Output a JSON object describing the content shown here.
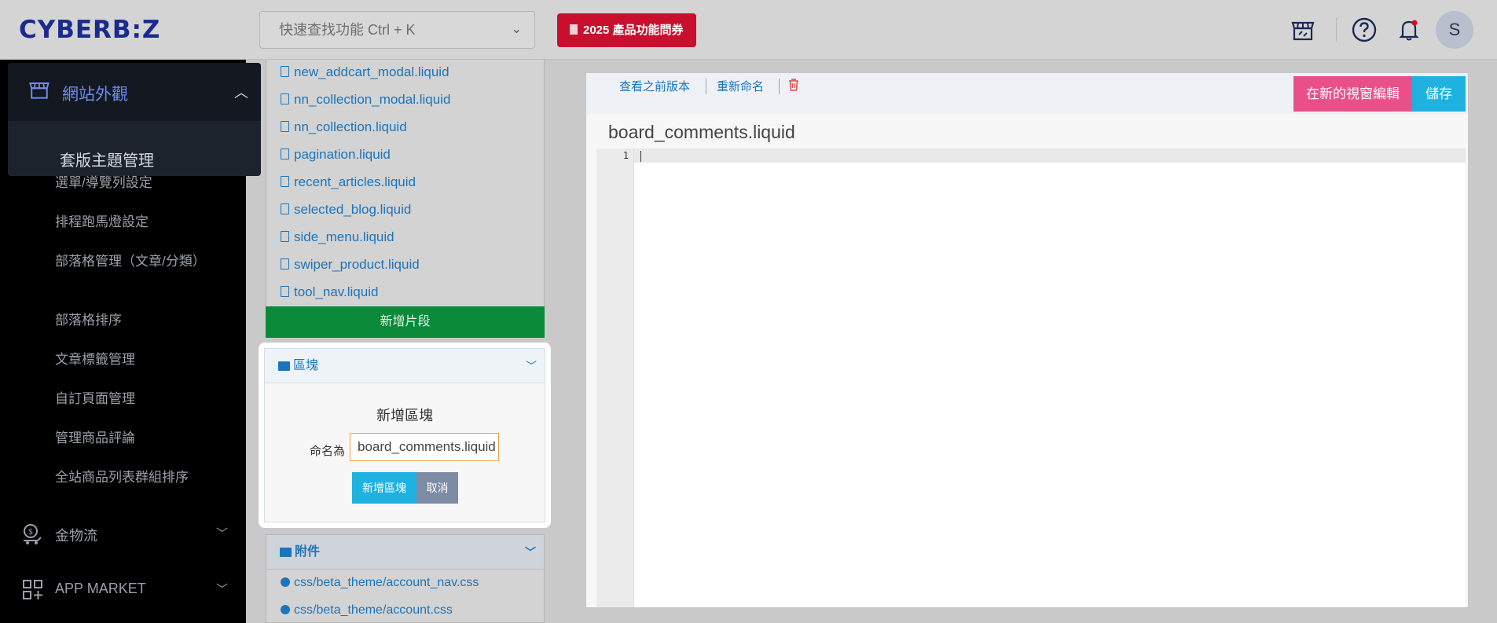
{
  "brand": {
    "logo": "CYBERB:Z"
  },
  "topbar": {
    "search_placeholder": "快速查找功能 Ctrl + K",
    "promo_label": "2025 產品功能問券",
    "avatar_initial": "S"
  },
  "sidebar": {
    "active_group": "網站外觀",
    "active_item": "套版主題管理",
    "items": [
      "選單/導覽列設定",
      "排程跑馬燈設定",
      "部落格管理（文章/分類）",
      "部落格排序",
      "文章標籤管理",
      "自訂頁面管理",
      "管理商品評論",
      "全站商品列表群組排序"
    ],
    "groups": [
      "金物流",
      "APP MARKET"
    ]
  },
  "snippets": {
    "files": [
      "new_addcart_modal.liquid",
      "nn_collection_modal.liquid",
      "nn_collection.liquid",
      "pagination.liquid",
      "recent_articles.liquid",
      "selected_blog.liquid",
      "side_menu.liquid",
      "swiper_product.liquid",
      "tool_nav.liquid"
    ],
    "add_label": "新增片段"
  },
  "blocks": {
    "header": "區塊",
    "form_title": "新增區塊",
    "name_label": "命名為",
    "name_value": "board_comments.liquid",
    "add_button": "新增區塊",
    "cancel_button": "取消"
  },
  "attachments": {
    "header": "附件",
    "files": [
      "css/beta_theme/account_nav.css",
      "css/beta_theme/account.css"
    ]
  },
  "editor": {
    "view_prev_label": "查看之前版本",
    "rename_label": "重新命名",
    "open_new_window_label": "在新的視窗編輯",
    "save_label": "儲存",
    "filename": "board_comments.liquid",
    "line_number": "1"
  },
  "colors": {
    "brand": "#1b2a8e",
    "link": "#1b75bc",
    "promo": "#c8102e",
    "add_snippet": "#0b8a3a",
    "primary": "#1fb2e0",
    "pink": "#e9508a"
  }
}
